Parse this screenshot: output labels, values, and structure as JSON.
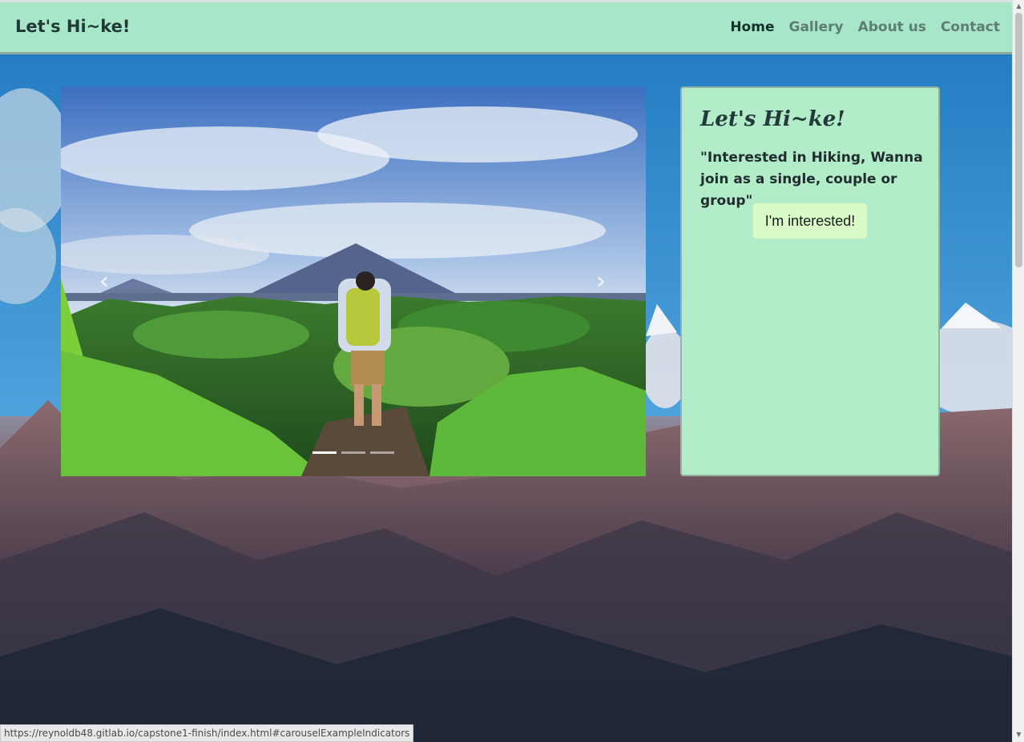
{
  "navbar": {
    "brand": "Let's Hi~ke!",
    "links": [
      {
        "label": "Home",
        "active": true
      },
      {
        "label": "Gallery",
        "active": false
      },
      {
        "label": "About us",
        "active": false
      },
      {
        "label": "Contact",
        "active": false
      }
    ]
  },
  "carousel": {
    "prev_glyph": "‹",
    "next_glyph": "›",
    "indicator_count": 3,
    "active_index": 0
  },
  "card": {
    "title": "Let's Hi~ke!",
    "text": "\"Interested in Hiking, Wanna join as a single, couple or group\"",
    "button_label": "I'm interested!"
  },
  "status_bar": {
    "url": "https://reynoldb48.gitlab.io/capstone1-finish/index.html#carouselExampleIndicators"
  },
  "colors": {
    "navbar_bg": "#afecc8",
    "card_bg": "#b3ecc8",
    "button_bg": "#d9fbc8"
  }
}
